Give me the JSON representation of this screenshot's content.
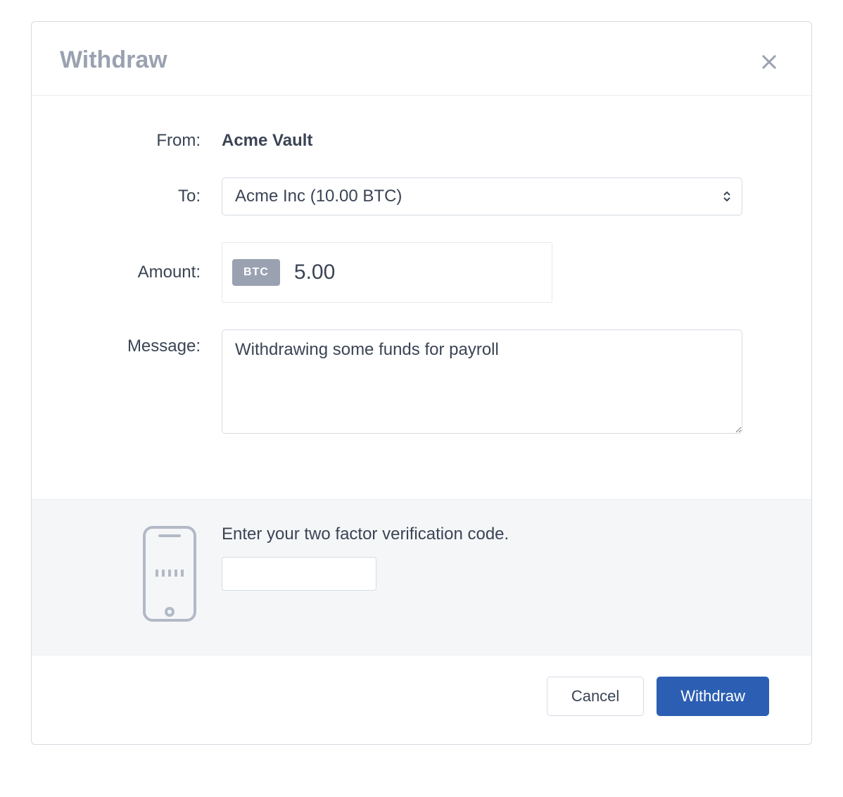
{
  "modal": {
    "title": "Withdraw"
  },
  "form": {
    "from_label": "From:",
    "from_value": "Acme Vault",
    "to_label": "To:",
    "to_selected": "Acme Inc (10.00 BTC)",
    "amount_label": "Amount:",
    "amount_currency": "BTC",
    "amount_value": "5.00",
    "message_label": "Message:",
    "message_value": "Withdrawing some funds for payroll"
  },
  "twofa": {
    "label": "Enter your two factor verification code.",
    "value": ""
  },
  "footer": {
    "cancel_label": "Cancel",
    "withdraw_label": "Withdraw"
  }
}
